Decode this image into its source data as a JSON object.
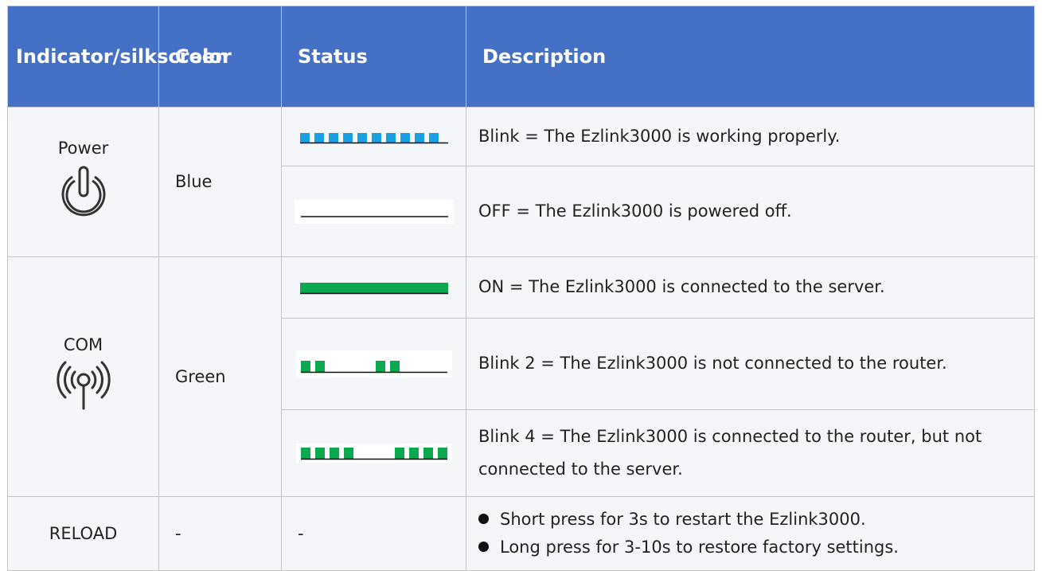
{
  "header": {
    "indicator": "Indicator/silkscreen",
    "color": "Color",
    "status": "Status",
    "description": "Description"
  },
  "rows": {
    "power": {
      "name": "Power",
      "icon": "power-icon",
      "color": "Blue",
      "blink_desc": "Blink = The Ezlink3000 is working properly.",
      "off_desc": "OFF = The Ezlink3000 is powered off."
    },
    "com": {
      "name": "COM",
      "icon": "antenna-signal-icon",
      "color": "Green",
      "on_desc": "ON = The Ezlink3000 is connected to the server.",
      "blink2_desc": "Blink 2 = The Ezlink3000 is not connected to the router.",
      "blink4_desc": "Blink 4 = The Ezlink3000 is connected to the router, but not connected to the server."
    },
    "reload": {
      "name": "RELOAD",
      "color": "-",
      "status": "-",
      "bullet1": "Short press for 3s to restart the Ezlink3000.",
      "bullet2": "Long press for 3-10s to restore factory settings."
    }
  },
  "colors": {
    "header_bg": "#4471c5",
    "row_bg": "#f4f6f9",
    "blue_led": "#1aa0e0",
    "green_led": "#0aa84f"
  }
}
